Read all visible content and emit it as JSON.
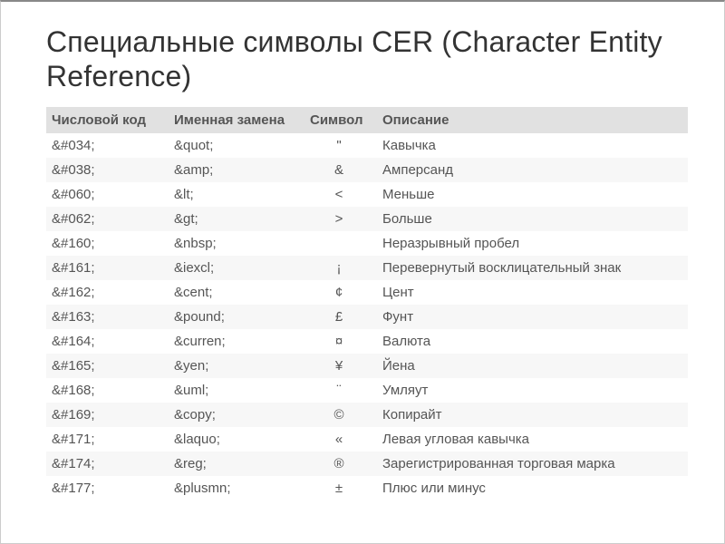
{
  "title": "Специальные символы CER (Character Entity Reference)",
  "columns": {
    "numeric": "Числовой код",
    "named": "Именная замена",
    "symbol": "Символ",
    "desc": "Описание"
  },
  "rows": [
    {
      "numeric": "&#034;",
      "named": "&quot;",
      "symbol": "\"",
      "desc": "Кавычка"
    },
    {
      "numeric": "&#038;",
      "named": "&amp;",
      "symbol": "&",
      "desc": "Амперсанд"
    },
    {
      "numeric": "&#060;",
      "named": "&lt;",
      "symbol": "<",
      "desc": "Меньше"
    },
    {
      "numeric": "&#062;",
      "named": "&gt;",
      "symbol": ">",
      "desc": "Больше"
    },
    {
      "numeric": "&#160;",
      "named": "&nbsp;",
      "symbol": " ",
      "desc": "Неразрывный пробел"
    },
    {
      "numeric": "&#161;",
      "named": "&iexcl;",
      "symbol": "¡",
      "desc": "Перевернутый восклицательный знак"
    },
    {
      "numeric": "&#162;",
      "named": "&cent;",
      "symbol": "¢",
      "desc": "Цент"
    },
    {
      "numeric": "&#163;",
      "named": "&pound;",
      "symbol": "£",
      "desc": "Фунт"
    },
    {
      "numeric": "&#164;",
      "named": "&curren;",
      "symbol": "¤",
      "desc": "Валюта"
    },
    {
      "numeric": "&#165;",
      "named": "&yen;",
      "symbol": "¥",
      "desc": "Йена"
    },
    {
      "numeric": "&#168;",
      "named": "&uml;",
      "symbol": "¨",
      "desc": "Умляут"
    },
    {
      "numeric": "&#169;",
      "named": "&copy;",
      "symbol": "©",
      "desc": "Копирайт"
    },
    {
      "numeric": "&#171;",
      "named": "&laquo;",
      "symbol": "«",
      "desc": "Левая угловая кавычка"
    },
    {
      "numeric": "&#174;",
      "named": "&reg;",
      "symbol": "®",
      "desc": "Зарегистрированная торговая марка"
    },
    {
      "numeric": "&#177;",
      "named": "&plusmn;",
      "symbol": "±",
      "desc": "Плюс или минус"
    }
  ]
}
